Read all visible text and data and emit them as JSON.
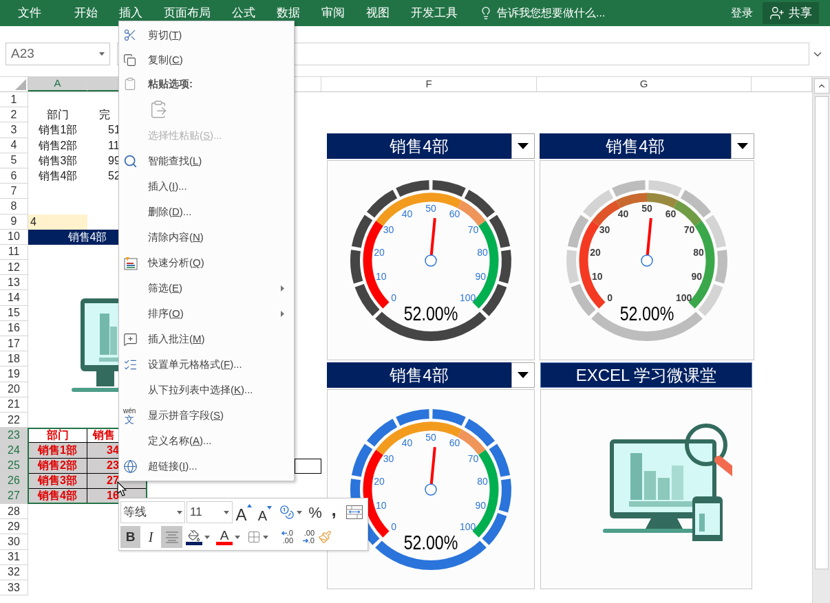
{
  "ribbon": {
    "tabs": [
      "文件",
      "开始",
      "插入",
      "页面布局",
      "公式",
      "数据",
      "审阅",
      "视图",
      "开发工具"
    ],
    "tell_me": "告诉我您想要做什么...",
    "sign_in": "登录",
    "share": "共享"
  },
  "name_box": "A23",
  "columns": [
    {
      "label": "A",
      "selected": true
    },
    {
      "selected": true
    },
    {
      "selected": false
    },
    {
      "label": "F",
      "selected": false
    },
    {
      "label": "G",
      "selected": false
    },
    {
      "selected": false
    }
  ],
  "rows": [
    {
      "number": "1",
      "selected": false,
      "kind": "empty"
    },
    {
      "number": "2",
      "selected": false,
      "kind": "header",
      "a": "部门",
      "b": "完"
    },
    {
      "number": "3",
      "selected": false,
      "kind": "plain",
      "a": "销售1部",
      "b": "51"
    },
    {
      "number": "4",
      "selected": false,
      "kind": "plain",
      "a": "销售2部",
      "b": "11"
    },
    {
      "number": "5",
      "selected": false,
      "kind": "plain",
      "a": "销售3部",
      "b": "99"
    },
    {
      "number": "6",
      "selected": false,
      "kind": "plain",
      "a": "销售4部",
      "b": "52"
    },
    {
      "number": "7",
      "selected": false,
      "kind": "empty"
    },
    {
      "number": "8",
      "selected": false,
      "kind": "empty"
    },
    {
      "number": "9",
      "selected": false,
      "kind": "input",
      "a": "4"
    },
    {
      "number": "10",
      "selected": false,
      "kind": "banner",
      "a": "销售4部"
    },
    {
      "number": "11",
      "selected": false,
      "kind": "empty"
    },
    {
      "number": "12",
      "selected": false,
      "kind": "empty"
    },
    {
      "number": "13",
      "selected": false,
      "kind": "empty"
    },
    {
      "number": "14",
      "selected": false,
      "kind": "empty"
    },
    {
      "number": "15",
      "selected": false,
      "kind": "empty"
    },
    {
      "number": "16",
      "selected": false,
      "kind": "empty"
    },
    {
      "number": "17",
      "selected": false,
      "kind": "empty"
    },
    {
      "number": "18",
      "selected": false,
      "kind": "empty"
    },
    {
      "number": "19",
      "selected": false,
      "kind": "empty"
    },
    {
      "number": "20",
      "selected": false,
      "kind": "empty"
    },
    {
      "number": "21",
      "selected": false,
      "kind": "empty"
    },
    {
      "number": "22",
      "selected": false,
      "kind": "empty"
    },
    {
      "number": "23",
      "selected": true,
      "kind": "table-header",
      "a": "部门",
      "b": "销售"
    },
    {
      "number": "24",
      "selected": true,
      "kind": "table-row",
      "a": "销售1部",
      "b": "34"
    },
    {
      "number": "25",
      "selected": true,
      "kind": "table-row",
      "a": "销售2部",
      "b": "23",
      "boxed": true
    },
    {
      "number": "26",
      "selected": true,
      "kind": "table-row",
      "a": "销售3部",
      "b": "27"
    },
    {
      "number": "27",
      "selected": true,
      "kind": "table-row",
      "a": "销售4部",
      "b": "16"
    },
    {
      "number": "28",
      "selected": false,
      "kind": "empty"
    },
    {
      "number": "29",
      "selected": false,
      "kind": "empty"
    },
    {
      "number": "30",
      "selected": false,
      "kind": "empty"
    },
    {
      "number": "31",
      "selected": false,
      "kind": "empty"
    },
    {
      "number": "32",
      "selected": false,
      "kind": "empty"
    },
    {
      "number": "33",
      "selected": false,
      "kind": "empty"
    }
  ],
  "panels": [
    {
      "kind": "gauge",
      "title": "销售4部",
      "ticks": [
        "0",
        "10",
        "20",
        "30",
        "40",
        "50",
        "60",
        "70",
        "80",
        "90",
        "100"
      ],
      "reading": "52.00%"
    },
    {
      "kind": "gauge",
      "title": "销售4部",
      "ticks": [
        "0",
        "10",
        "20",
        "30",
        "40",
        "50",
        "60",
        "70",
        "80",
        "90",
        "100"
      ],
      "reading": "52.00%"
    },
    {
      "kind": "gauge",
      "title": "销售4部",
      "ticks": [
        "0",
        "10",
        "20",
        "30",
        "40",
        "50",
        "60",
        "70",
        "80",
        "90",
        "100"
      ],
      "reading": "52.00%"
    },
    {
      "kind": "picture",
      "title": "EXCEL 学习微课堂"
    }
  ],
  "context_menu": [
    {
      "kind": "command",
      "before": "剪切(",
      "key": "T",
      "after": ")",
      "disabled": false,
      "submenu": false
    },
    {
      "kind": "command",
      "before": "复制(",
      "key": "C",
      "after": ")",
      "disabled": false,
      "submenu": false
    },
    {
      "kind": "header",
      "before": "粘贴选项:"
    },
    {
      "kind": "paste-options"
    },
    {
      "kind": "command",
      "before": "选择性粘贴(",
      "key": "S",
      "after": ")...",
      "disabled": true,
      "submenu": false
    },
    {
      "kind": "command",
      "before": "智能查找(",
      "key": "L",
      "after": ")",
      "disabled": false,
      "submenu": false
    },
    {
      "kind": "command",
      "before": "插入(",
      "key": "I",
      "after": ")...",
      "disabled": false,
      "submenu": false
    },
    {
      "kind": "command",
      "before": "删除(",
      "key": "D",
      "after": ")...",
      "disabled": false,
      "submenu": false
    },
    {
      "kind": "command",
      "before": "清除内容(",
      "key": "N",
      "after": ")",
      "disabled": false,
      "submenu": false
    },
    {
      "kind": "command",
      "before": "快速分析(",
      "key": "Q",
      "after": ")",
      "disabled": false,
      "submenu": false
    },
    {
      "kind": "command",
      "before": "筛选(",
      "key": "E",
      "after": ")",
      "disabled": false,
      "submenu": true
    },
    {
      "kind": "command",
      "before": "排序(",
      "key": "O",
      "after": ")",
      "disabled": false,
      "submenu": true
    },
    {
      "kind": "command",
      "before": "插入批注(",
      "key": "M",
      "after": ")",
      "disabled": false,
      "submenu": false
    },
    {
      "kind": "command",
      "before": "设置单元格格式(",
      "key": "F",
      "after": ")...",
      "disabled": false,
      "submenu": false
    },
    {
      "kind": "command",
      "before": "从下拉列表中选择(",
      "key": "K",
      "after": ")...",
      "disabled": false,
      "submenu": false
    },
    {
      "kind": "command",
      "icon_text": [
        "wén",
        "文"
      ],
      "before": "显示拼音字段(",
      "key": "S",
      "after": ")",
      "disabled": false,
      "submenu": false
    },
    {
      "kind": "command",
      "before": "定义名称(",
      "key": "A",
      "after": ")...",
      "disabled": false,
      "submenu": false
    },
    {
      "kind": "command",
      "before": "超链接(",
      "key": "I",
      "after": ")...",
      "disabled": false,
      "submenu": false
    }
  ],
  "mini_toolbar": {
    "font": "等线",
    "size": "11",
    "row1": [
      {
        "kind": "grow-font",
        "label": "A"
      },
      {
        "kind": "shrink-font",
        "label": "A"
      },
      {
        "kind": "accounting"
      },
      {
        "kind": "percent",
        "label": "%"
      },
      {
        "kind": "comma",
        "label": ","
      },
      {
        "kind": "wrap"
      }
    ],
    "row2": [
      {
        "kind": "bold",
        "label": "B",
        "pressed": true
      },
      {
        "kind": "italic",
        "label": "I",
        "pressed": false
      },
      {
        "kind": "center",
        "pressed": true
      },
      {
        "kind": "fill-color",
        "color": "#002060",
        "pressed": false
      },
      {
        "kind": "font-color",
        "label": "A",
        "color": "#ff0000",
        "pressed": false
      },
      {
        "kind": "borders",
        "pressed": false
      },
      {
        "kind": "increase-decimal",
        "lines": [
          ".0",
          ".00"
        ],
        "pressed": false
      },
      {
        "kind": "decrease-decimal",
        "lines": [
          ".00",
          ".0"
        ],
        "pressed": false
      },
      {
        "kind": "format-painter",
        "pressed": false
      }
    ]
  }
}
